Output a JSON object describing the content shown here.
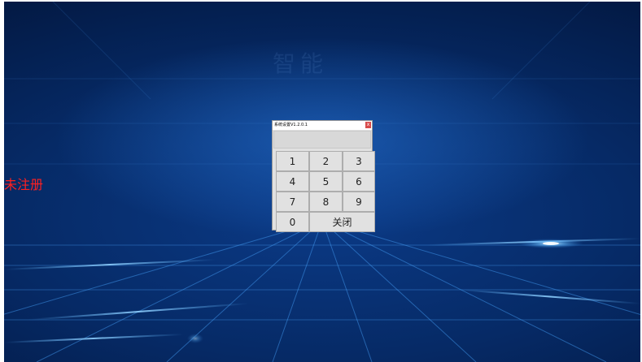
{
  "desktop": {
    "watermark": "智能",
    "status_label": "未注册"
  },
  "dialog": {
    "title": "系统设置V1.2.0.1",
    "close_glyph": "x",
    "keypad": {
      "row1": [
        "1",
        "2",
        "3"
      ],
      "row2": [
        "4",
        "5",
        "6"
      ],
      "row3": [
        "7",
        "8",
        "9"
      ],
      "zero": "0",
      "close_label": "关闭"
    }
  },
  "colors": {
    "background_deep": "#031a45",
    "background_mid": "#0b3a86",
    "status_text": "#ff2020",
    "dialog_bg": "#e1e1e1",
    "close_button": "#d84b4b"
  }
}
